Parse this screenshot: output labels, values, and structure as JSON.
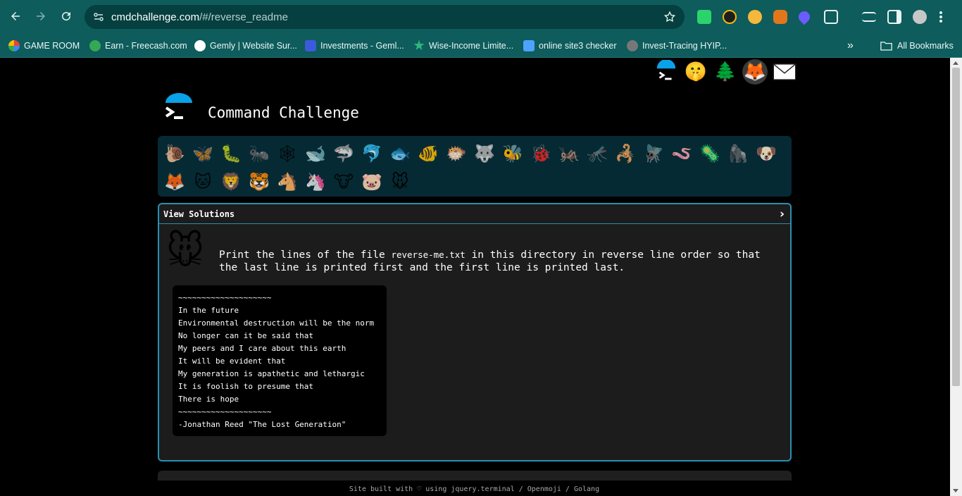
{
  "browser": {
    "url_host": "cmdchallenge.com",
    "url_path": "/#/reverse_readme",
    "bookmarks": [
      {
        "label": "GAME ROOM",
        "color": "#e94335"
      },
      {
        "label": "Earn - Freecash.com",
        "color": "#34a853"
      },
      {
        "label": "Gemly | Website Sur...",
        "color": "#ffffff"
      },
      {
        "label": "Investments - Geml...",
        "color": "#3b5bdb"
      },
      {
        "label": "Wise-Income Limite...",
        "color": "#2fb67d"
      },
      {
        "label": "online site3 checker",
        "color": "#4da3ff"
      },
      {
        "label": "Invest-Tracing HYIP...",
        "color": "#777777"
      }
    ],
    "all_bookmarks": "All Bookmarks",
    "overflow": "»"
  },
  "header": {
    "title": "Command Challenge",
    "top_icons": [
      {
        "name": "terminal-icon",
        "glyph": "🖥"
      },
      {
        "name": "shush-face-icon",
        "glyph": "🤫"
      },
      {
        "name": "tree-icon",
        "glyph": "🌲"
      },
      {
        "name": "gitlab-fox-icon",
        "glyph": "🦊"
      },
      {
        "name": "envelope-icon",
        "glyph": "✉"
      }
    ]
  },
  "challenges": [
    {
      "name": "snail",
      "glyph": "🐌"
    },
    {
      "name": "butterfly",
      "glyph": "🦋"
    },
    {
      "name": "caterpillar",
      "glyph": "🐛"
    },
    {
      "name": "ant",
      "glyph": "🐜"
    },
    {
      "name": "spider-web",
      "glyph": "🕸"
    },
    {
      "name": "whale",
      "glyph": "🐋"
    },
    {
      "name": "shark",
      "glyph": "🦈"
    },
    {
      "name": "dolphin",
      "glyph": "🐬"
    },
    {
      "name": "fish",
      "glyph": "🐟"
    },
    {
      "name": "tropical-fish",
      "glyph": "🐠"
    },
    {
      "name": "blowfish",
      "glyph": "🐡"
    },
    {
      "name": "wolf",
      "glyph": "🐺"
    },
    {
      "name": "bee",
      "glyph": "🐝"
    },
    {
      "name": "ladybug",
      "glyph": "🐞"
    },
    {
      "name": "cricket",
      "glyph": "🦗"
    },
    {
      "name": "mosquito",
      "glyph": "🦟"
    },
    {
      "name": "scorpion",
      "glyph": "🦂"
    },
    {
      "name": "fly",
      "glyph": "🪰"
    },
    {
      "name": "worm",
      "glyph": "🪱"
    },
    {
      "name": "microbe",
      "glyph": "🦠"
    },
    {
      "name": "gorilla",
      "glyph": "🦍"
    },
    {
      "name": "dog",
      "glyph": "🐶"
    },
    {
      "name": "fox",
      "glyph": "🦊"
    },
    {
      "name": "cat",
      "glyph": "🐱"
    },
    {
      "name": "lion",
      "glyph": "🦁"
    },
    {
      "name": "tiger",
      "glyph": "🐯"
    },
    {
      "name": "horse",
      "glyph": "🐴"
    },
    {
      "name": "unicorn",
      "glyph": "🦄"
    },
    {
      "name": "cow",
      "glyph": "🐮"
    },
    {
      "name": "pig",
      "glyph": "🐷"
    },
    {
      "name": "mouse",
      "glyph": "🐭"
    }
  ],
  "panel": {
    "header_label": "View Solutions",
    "chevron": "›",
    "challenge_glyph": "🐭",
    "desc_before": "Print the lines of the file ",
    "desc_file": "reverse-me.txt",
    "desc_after": " in this directory in reverse line order so that the last line is printed first and the first line is printed last.",
    "poem": [
      "~~~~~~~~~~~~~~~~~~~~",
      "In the future",
      "Environmental destruction will be the norm",
      "No longer can it be said that",
      "My peers and I care about this earth",
      "It will be evident that",
      "My generation is apathetic and lethargic",
      "It is foolish to presume that",
      "There is hope",
      "~~~~~~~~~~~~~~~~~~~~",
      "-Jonathan Reed \"The Lost Generation\""
    ]
  },
  "footer": "Site built with ♡ using jquery.terminal / Openmoji / Golang"
}
